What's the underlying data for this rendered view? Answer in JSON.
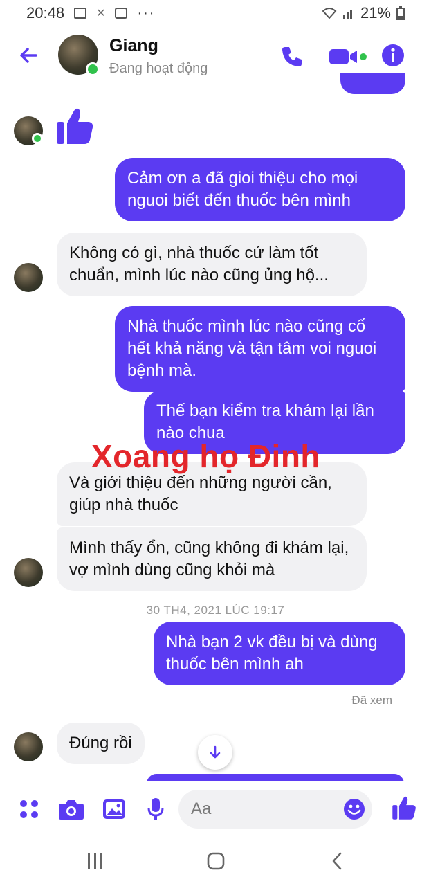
{
  "status_bar": {
    "time": "20:48",
    "battery": "21%"
  },
  "header": {
    "contact_name": "Giang",
    "contact_status": "Đang hoạt động"
  },
  "messages": [
    {
      "dir": "out",
      "text": "Cảm ơn a đã gioi thiệu cho mọi nguoi biết đến thuốc bên mình"
    },
    {
      "dir": "in",
      "text": "Không có gì, nhà thuốc cứ làm tốt chuẩn, mình lúc nào cũng ủng hộ..."
    },
    {
      "dir": "out",
      "text": "Nhà thuốc mình lúc nào cũng cố hết khả năng và tận tâm voi nguoi bệnh mà."
    },
    {
      "dir": "out",
      "text": "Thế bạn kiểm tra khám lại lần nào chua"
    },
    {
      "dir": "in",
      "text": "Và giới thiệu đến những người cần, giúp nhà thuốc"
    },
    {
      "dir": "in",
      "text": "Mình thấy ổn, cũng không đi khám lại, vợ mình dùng cũng khỏi mà"
    },
    {
      "dir": "out",
      "text": "Nhà bạn 2 vk đều bị và dùng thuốc bên mình ah"
    },
    {
      "dir": "in",
      "text": "Đúng rồi"
    }
  ],
  "timestamp": "30 TH4, 2021 LÚC 19:17",
  "seen_label": "Đã xem",
  "watermark": "Xoang họ Đinh",
  "composer": {
    "placeholder": "Aa"
  },
  "colors": {
    "accent": "#5b3bf2",
    "bubble_in": "#f1f1f3",
    "watermark": "#e3262b",
    "online": "#31c24c"
  },
  "icons": {
    "header": [
      "back-arrow-icon",
      "phone-icon",
      "video-call-icon",
      "info-icon"
    ],
    "composer": [
      "menu-dots-icon",
      "camera-icon",
      "gallery-icon",
      "microphone-icon",
      "emoji-icon",
      "like-icon"
    ],
    "nav": [
      "recents-icon",
      "home-icon",
      "back-icon"
    ]
  }
}
